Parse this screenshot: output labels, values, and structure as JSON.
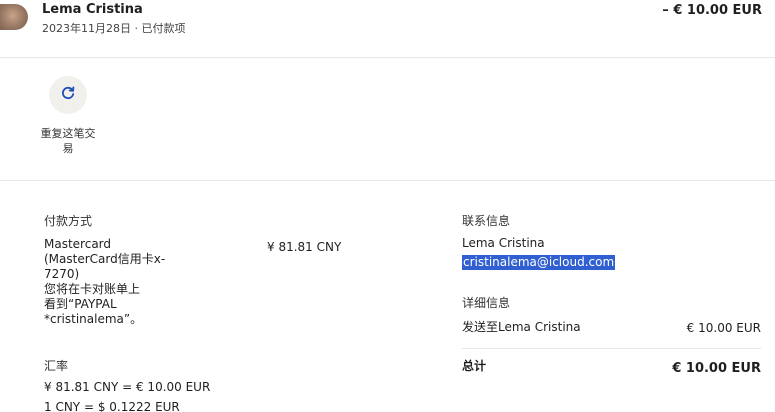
{
  "header": {
    "payee_name": "Lema Cristina",
    "subline": "2023年11月28日 · 已付款项",
    "amount": "– € 10.00 EUR"
  },
  "actions": {
    "repeat_label": "重复这笔交易",
    "repeat_icon": "refresh-icon"
  },
  "payment_method": {
    "title": "付款方式",
    "description": "Mastercard\n(MasterCard信用卡x-7270)\n您将在卡对账单上看到“PAYPAL *cristinalema”。",
    "amount": "¥ 81.81 CNY"
  },
  "exchange_rate": {
    "title": "汇率",
    "line1": "¥ 81.81 CNY = € 10.00 EUR",
    "line2": "1 CNY = $ 0.1222 EUR"
  },
  "contact": {
    "title": "联系信息",
    "name": "Lema Cristina",
    "email": "cristinalema@icloud.com"
  },
  "details": {
    "title": "详细信息",
    "sent_to_label": "发送至Lema Cristina",
    "sent_to_amount": "€ 10.00 EUR",
    "total_label": "总计",
    "total_amount": "€ 10.00 EUR"
  },
  "colors": {
    "accent": "#2f5fd0",
    "icon_bg": "#f2f0ec"
  }
}
